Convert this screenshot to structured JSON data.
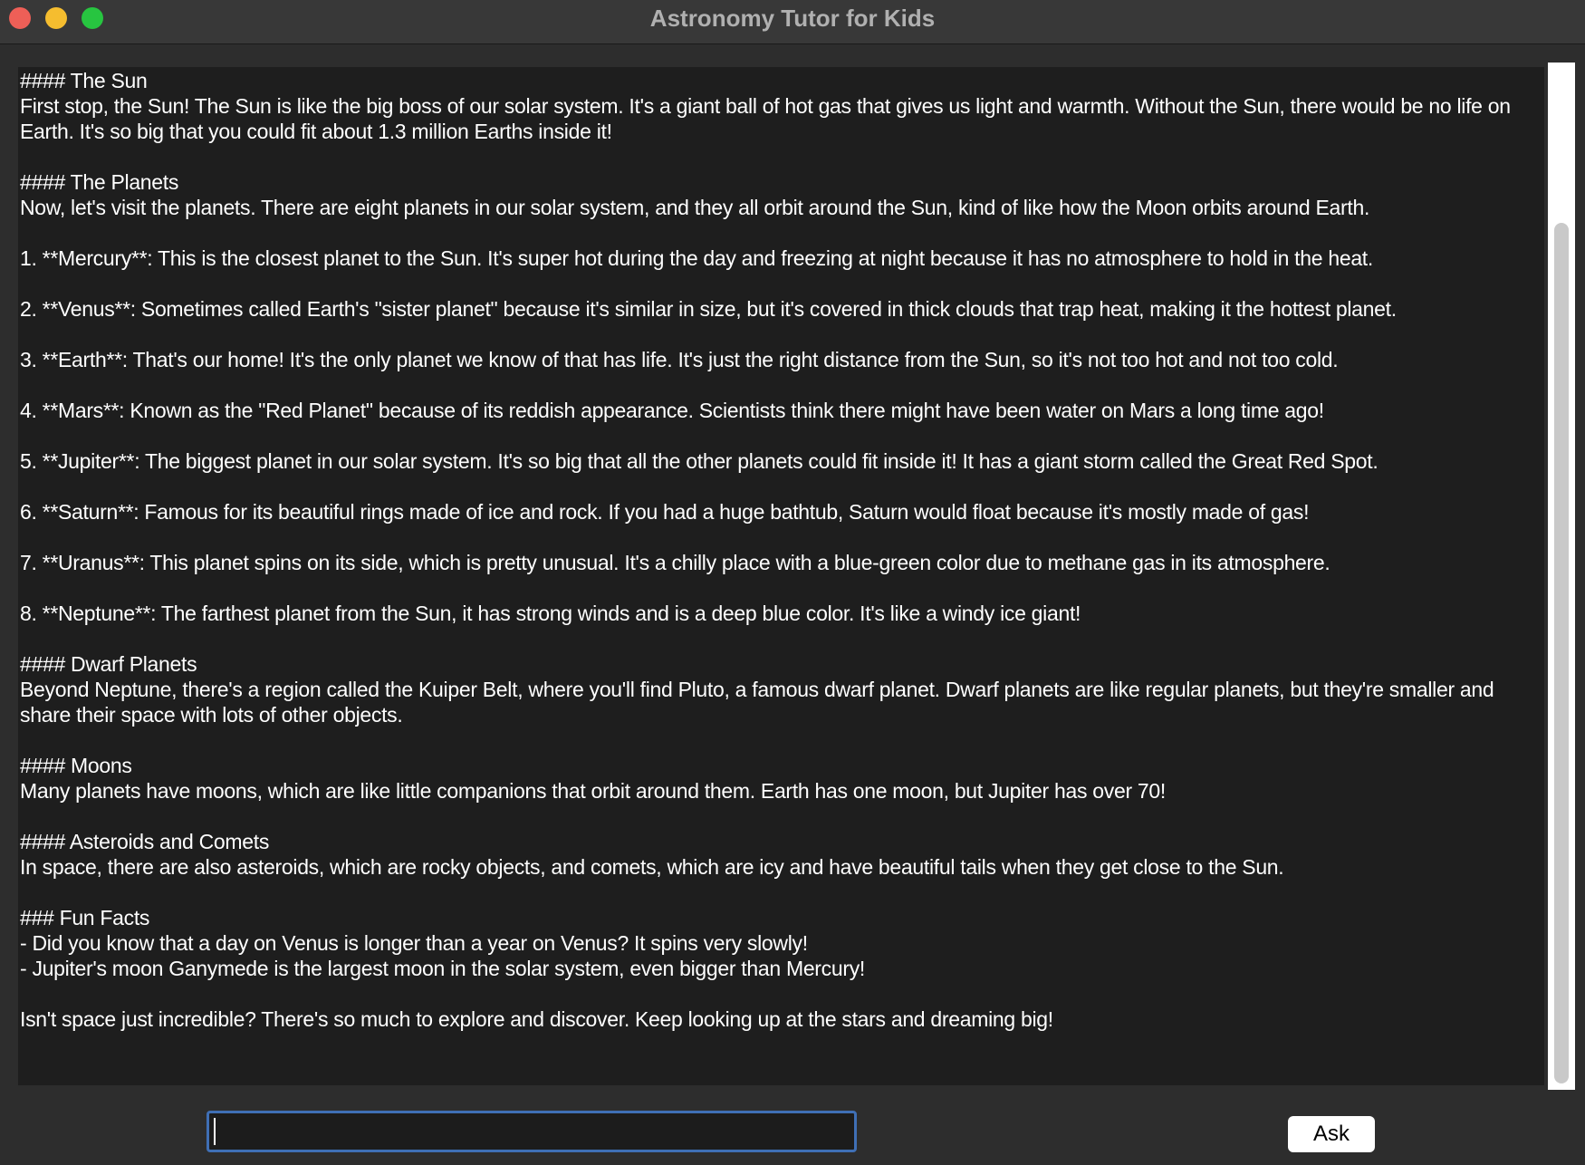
{
  "window": {
    "title": "Astronomy Tutor for Kids"
  },
  "content": {
    "lines": [
      "#### The Sun",
      "First stop, the Sun! The Sun is like the big boss of our solar system. It's a giant ball of hot gas that gives us light and warmth. Without the Sun, there would be no life on Earth. It's so big that you could fit about 1.3 million Earths inside it!",
      "",
      "#### The Planets",
      "Now, let's visit the planets. There are eight planets in our solar system, and they all orbit around the Sun, kind of like how the Moon orbits around Earth.",
      "",
      "1. **Mercury**: This is the closest planet to the Sun. It's super hot during the day and freezing at night because it has no atmosphere to hold in the heat.",
      "",
      "2. **Venus**: Sometimes called Earth's \"sister planet\" because it's similar in size, but it's covered in thick clouds that trap heat, making it the hottest planet.",
      "",
      "3. **Earth**: That's our home! It's the only planet we know of that has life. It's just the right distance from the Sun, so it's not too hot and not too cold.",
      "",
      "4. **Mars**: Known as the \"Red Planet\" because of its reddish appearance. Scientists think there might have been water on Mars a long time ago!",
      "",
      "5. **Jupiter**: The biggest planet in our solar system. It's so big that all the other planets could fit inside it! It has a giant storm called the Great Red Spot.",
      "",
      "6. **Saturn**: Famous for its beautiful rings made of ice and rock. If you had a huge bathtub, Saturn would float because it's mostly made of gas!",
      "",
      "7. **Uranus**: This planet spins on its side, which is pretty unusual. It's a chilly place with a blue-green color due to methane gas in its atmosphere.",
      "",
      "8. **Neptune**: The farthest planet from the Sun, it has strong winds and is a deep blue color. It's like a windy ice giant!",
      "",
      "#### Dwarf Planets",
      "Beyond Neptune, there's a region called the Kuiper Belt, where you'll find Pluto, a famous dwarf planet. Dwarf planets are like regular planets, but they're smaller and share their space with lots of other objects.",
      "",
      "#### Moons",
      "Many planets have moons, which are like little companions that orbit around them. Earth has one moon, but Jupiter has over 70!",
      "",
      "#### Asteroids and Comets",
      "In space, there are also asteroids, which are rocky objects, and comets, which are icy and have beautiful tails when they get close to the Sun.",
      "",
      "### Fun Facts",
      "- Did you know that a day on Venus is longer than a year on Venus? It spins very slowly!",
      "- Jupiter's moon Ganymede is the largest moon in the solar system, even bigger than Mercury!",
      "",
      "Isn't space just incredible? There's so much to explore and discover. Keep looking up at the stars and dreaming big!"
    ]
  },
  "input": {
    "value": "",
    "placeholder": ""
  },
  "ask_button": {
    "label": "Ask"
  }
}
